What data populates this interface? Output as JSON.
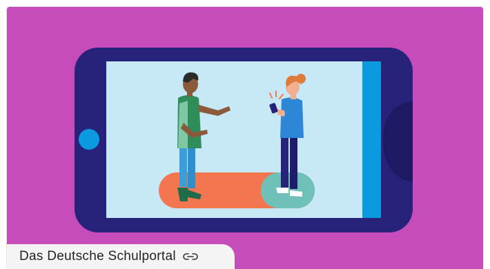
{
  "source": {
    "name": "Das Deutsche Schulportal",
    "icon": "link-icon"
  },
  "colors": {
    "background": "#c64cbc",
    "tablet_frame": "#27237a",
    "screen": "#c7e9f7",
    "side_bar": "#0a9ae0",
    "home_button": "#0a9ae0",
    "slider_track": "#f47651",
    "slider_knob": "#6fc0b7",
    "caption_bar": "#f4f4f4"
  },
  "illustration": {
    "toggle_state": "on"
  }
}
